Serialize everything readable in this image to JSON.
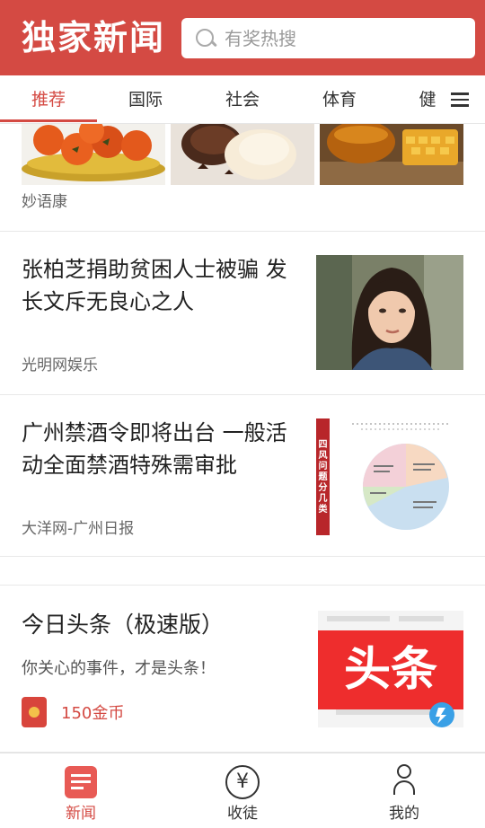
{
  "header": {
    "logo": "独家新闻",
    "search_placeholder": "有奖热搜"
  },
  "tabs": [
    {
      "label": "推荐",
      "active": true
    },
    {
      "label": "国际",
      "active": false
    },
    {
      "label": "社会",
      "active": false
    },
    {
      "label": "体育",
      "active": false
    },
    {
      "label": "健",
      "active": false
    }
  ],
  "feed": {
    "item1": {
      "source": "妙语康"
    },
    "item2": {
      "title_line1": "张柏芝捐助贫困人士被骗 发",
      "title_line2": "长文斥无良心之人",
      "source": "光明网娱乐"
    },
    "item3": {
      "title_line1": "广州禁酒令即将出台 一般活",
      "title_line2": "动全面禁酒特殊需审批",
      "source": "大洋网-广州日报",
      "image_caption": "四风问题分几类"
    },
    "ad": {
      "title": "今日头条（极速版）",
      "subtitle": "你关心的事件，才是头条！",
      "coins": "150金币",
      "image_text": "头条"
    }
  },
  "bottom_nav": [
    {
      "label": "新闻",
      "icon": "news-icon",
      "active": true
    },
    {
      "label": "收徒",
      "icon": "yen-icon",
      "active": false
    },
    {
      "label": "我的",
      "icon": "profile-icon",
      "active": false
    }
  ],
  "colors": {
    "accent": "#d44a43",
    "text_primary": "#222222",
    "text_secondary": "#666666"
  }
}
